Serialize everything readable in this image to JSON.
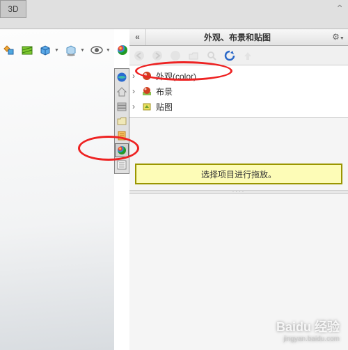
{
  "top_box_label": "3D",
  "panel": {
    "collapse": "«",
    "title": "外观、布景和贴图",
    "gear_icon": "gear"
  },
  "toolbar_nav": {
    "back": "back",
    "forward": "forward",
    "home": "home",
    "new_folder": "new-folder",
    "search": "search",
    "refresh": "refresh",
    "up": "up"
  },
  "tree": [
    {
      "label": "外观(color)",
      "icon": "color-sphere"
    },
    {
      "label": "布景",
      "icon": "scene-sphere"
    },
    {
      "label": "贴图",
      "icon": "decal"
    }
  ],
  "drop_hint": "选择项目进行拖放。",
  "watermark": {
    "brand": "Baidu 经验",
    "sub": "jingyan.baidu.com"
  },
  "horiz_icons": {
    "assembly": "assembly",
    "hatch": "hatch",
    "box": "box",
    "cube_shadow": "cube-shadow",
    "eye": "eye",
    "rgb": "rgb-sphere"
  },
  "vert_icons": {
    "globe": "globe",
    "home": "home",
    "stack": "stack",
    "folder": "folder",
    "tree": "tree",
    "rgb": "rgb-sphere",
    "list": "list"
  }
}
